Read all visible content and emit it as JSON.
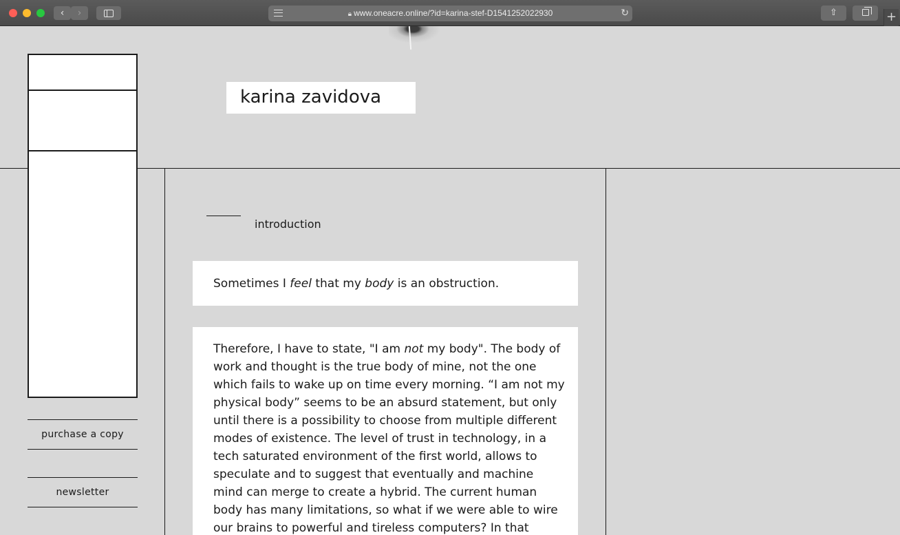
{
  "browser": {
    "url": "www.oneacre.online/?id=karina-stef-D1541252022930",
    "back_label": "‹",
    "forward_label": "›",
    "reload_label": "↻",
    "new_tab_label": "+",
    "share_label": "⇧"
  },
  "header": {
    "author": "karina zavidova"
  },
  "sidebar": {
    "purchase_label": "purchase a copy",
    "newsletter_label": "newsletter"
  },
  "article": {
    "section_title": "introduction",
    "quote": {
      "part1": "Sometimes I ",
      "em1": "feel",
      "part2": " that my ",
      "em2": "body",
      "part3": " is an obstruction."
    },
    "body": {
      "line1_a": "Therefore, I have to state, \"I am ",
      "line1_em": "not",
      "line1_b": " my body\". The body of",
      "lines": [
        "work and thought is the true body of mine, not the one",
        "which fails to wake up on time every morning. “I am not my",
        "physical body” seems to be an absurd statement, but only",
        "until there is a possibility to choose from multiple different",
        "modes of existence. The level of trust in technology, in a",
        "tech saturated environment of the first world, allows to",
        "speculate and to suggest that eventually and machine",
        "mind can merge to create a hybrid. The current human",
        "body has many limitations, so what if we were able to wire",
        "our brains to powerful and tireless computers? In that"
      ]
    }
  },
  "colors": {
    "page_background": "#d8d8d8",
    "panel": "#ffffff",
    "ink": "#1a1a1a"
  }
}
